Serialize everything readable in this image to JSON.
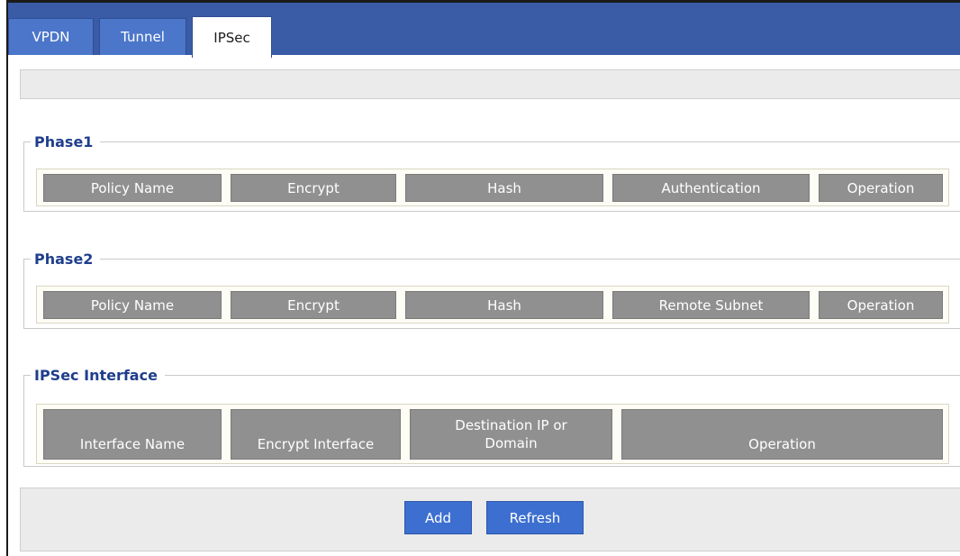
{
  "tabs": [
    {
      "label": "VPDN",
      "active": false
    },
    {
      "label": "Tunnel",
      "active": false
    },
    {
      "label": "IPSec",
      "active": true
    }
  ],
  "phase1": {
    "title": "Phase1",
    "columns": [
      "Policy Name",
      "Encrypt",
      "Hash",
      "Authentication",
      "Operation"
    ]
  },
  "phase2": {
    "title": "Phase2",
    "columns": [
      "Policy Name",
      "Encrypt",
      "Hash",
      "Remote Subnet",
      "Operation"
    ]
  },
  "ipsec_interface": {
    "title": "IPSec Interface",
    "columns": [
      "Interface Name",
      "Encrypt Interface",
      "Destination IP or Domain",
      "Operation"
    ]
  },
  "actions": {
    "add_label": "Add",
    "refresh_label": "Refresh"
  },
  "colors": {
    "tabbar": "#3a5ba5",
    "tab_inactive": "#4b76c9",
    "header_cell": "#909090",
    "legend_text": "#1f3e8c",
    "button": "#3c6fd0"
  }
}
